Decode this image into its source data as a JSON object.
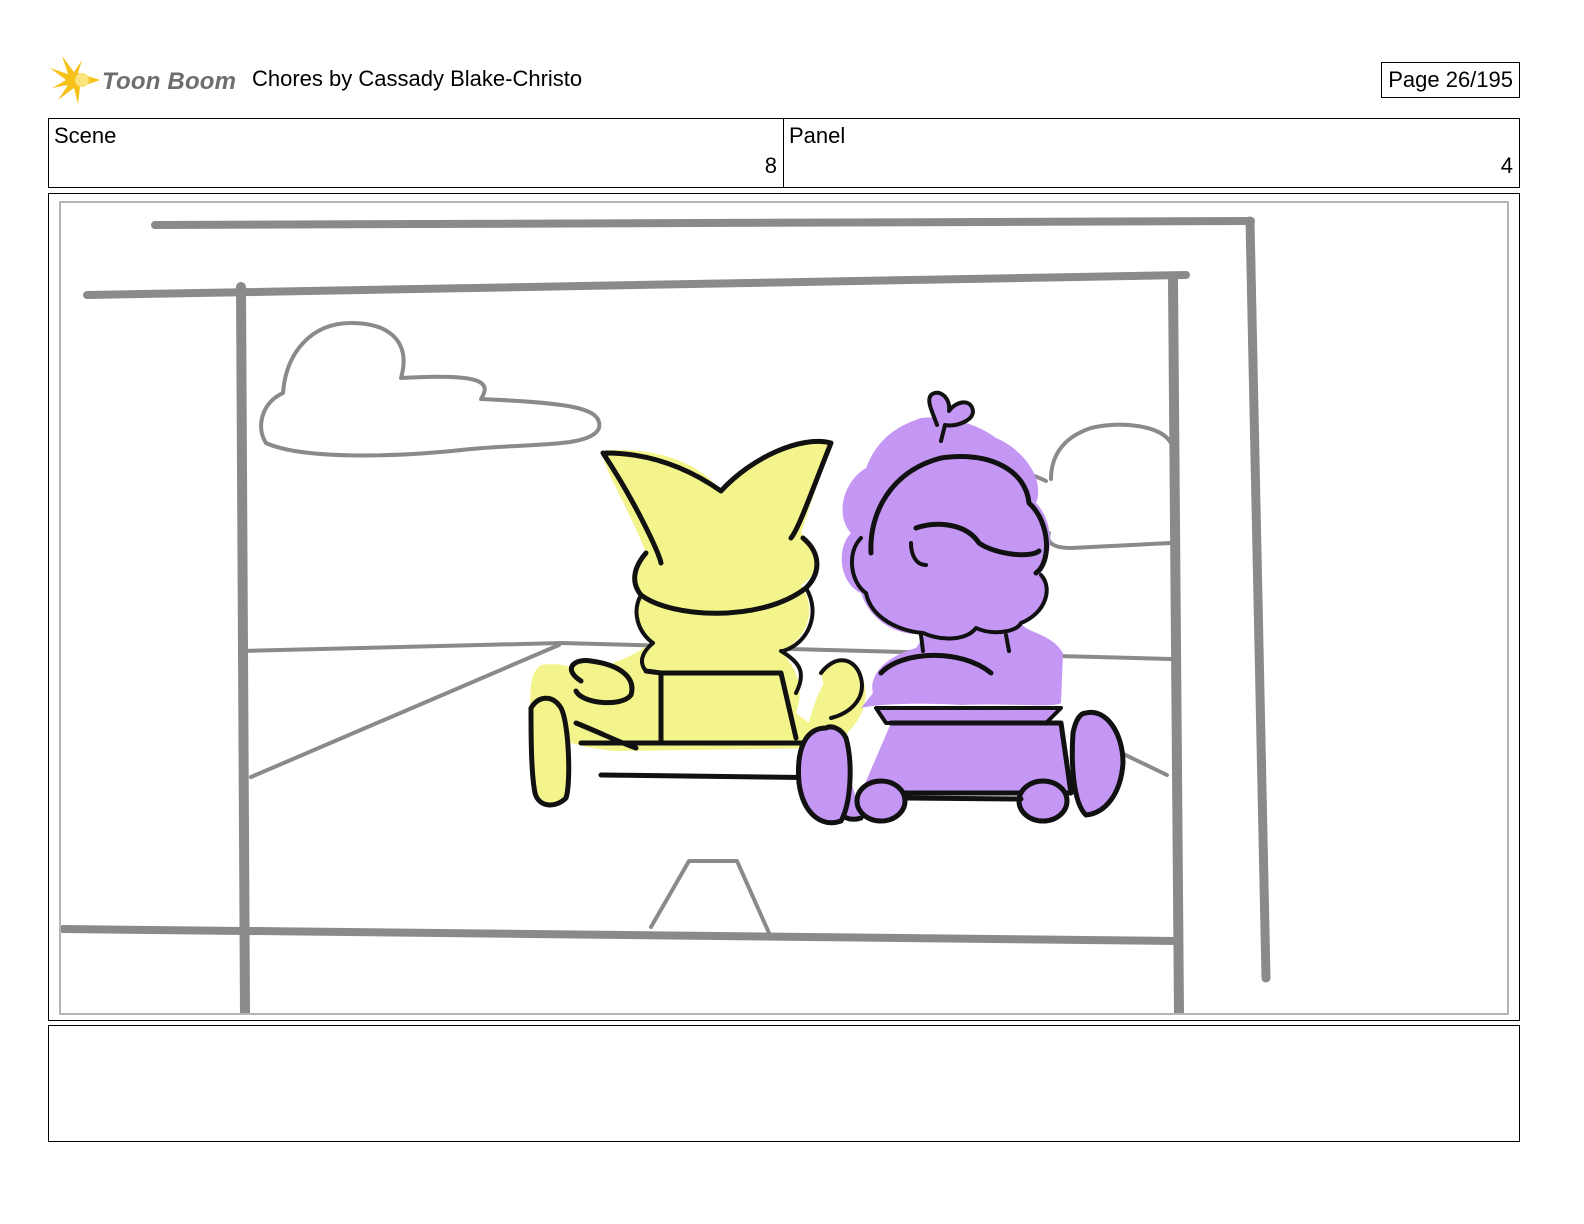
{
  "header": {
    "logo_text": "Toon Boom",
    "title": "Chores  by Cassady Blake-Christo",
    "page_label": "Page  26/195"
  },
  "info": {
    "scene_label": "Scene",
    "scene_value": "8",
    "panel_label": "Panel",
    "panel_value": "4"
  },
  "colors": {
    "logo_star": "#f6c21a",
    "logo_text": "#6e6e6e",
    "sketch_gray": "#8a8a8a",
    "yellow_character": "#f4f48c",
    "purple_character": "#c597f5",
    "ink": "#111111"
  },
  "notes": {
    "text": ""
  }
}
